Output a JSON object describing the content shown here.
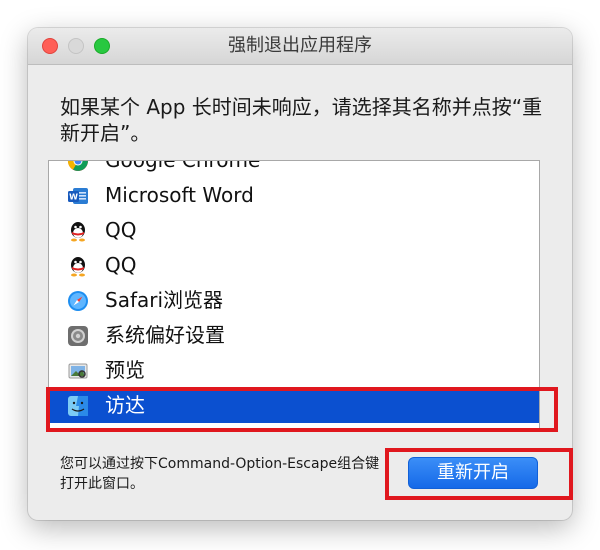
{
  "window": {
    "title": "强制退出应用程序"
  },
  "instruction": "如果某个 App 长时间未响应，请选择其名称并点按“重新开启”。",
  "apps": [
    {
      "label": "Google Chrome",
      "icon": "chrome-icon"
    },
    {
      "label": "Microsoft Word",
      "icon": "word-icon"
    },
    {
      "label": "QQ",
      "icon": "qq-icon"
    },
    {
      "label": "QQ",
      "icon": "qq-icon"
    },
    {
      "label": "Safari浏览器",
      "icon": "safari-icon"
    },
    {
      "label": "系统偏好设置",
      "icon": "system-preferences-icon"
    },
    {
      "label": "预览",
      "icon": "preview-icon"
    },
    {
      "label": "访达",
      "icon": "finder-icon",
      "selected": true
    }
  ],
  "footer": {
    "hint": "您可以通过按下Command-Option-Escape组合键打开此窗口。",
    "restart_label": "重新开启"
  },
  "colors": {
    "selection": "#0b50d0",
    "button": "#1569e8",
    "highlight": "#e0171e"
  }
}
